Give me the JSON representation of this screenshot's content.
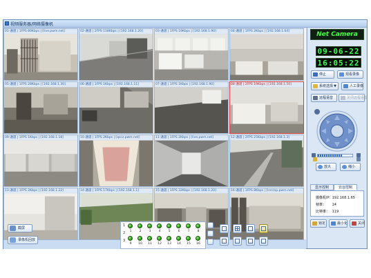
{
  "window": {
    "title": "视频服务器/网络摄像机"
  },
  "cameras": [
    {
      "caption": "01-通道 | 1FPS 80Kbps | [live.pwm.net]"
    },
    {
      "caption": "02-通道 | 2FPS 118Kbps | [192.168.1.20]"
    },
    {
      "caption": "03-通道 | 1FPS 19Kbps | [192.168.1.90]"
    },
    {
      "caption": "04-通道 | 1FPS 2Kbps | [192.168.1.64]"
    },
    {
      "caption": "05-通道 | 1FPS 28Kbps | [192.168.1.30]"
    },
    {
      "caption": "06-通道 | 1FPS 1Kbps | [192.168.1.11]"
    },
    {
      "caption": "07-通道 | 1FPS 1Kbps | [192.168.1.90]"
    },
    {
      "caption": "08-通道 | 2FPS 19Kbps | [192.168.1.50]"
    },
    {
      "caption": "09-通道 | 1FPS 1Kbps | [192.168.1.18]"
    },
    {
      "caption": "10-通道 | 1FPS 2Kbps | [qscz.pwm.net]"
    },
    {
      "caption": "11-通道 | 1FPS 2Kbps | [live.pwm.net]"
    },
    {
      "caption": "12-通道 | 2FPS 25Kbps | [192.168.1.3]"
    },
    {
      "caption": "13-通道 | 1FPS 2Kbps | [192.168.1.22]"
    },
    {
      "caption": "14-通道 | 1FPS 17Kbps | [192.168.1.1]"
    },
    {
      "caption": "15-通道 | 1FPS 32Kbps | [192.168.1.20]"
    },
    {
      "caption": "16-通道 | 1FPS 8Kbps | [lsrcmp.pwm.net]"
    }
  ],
  "bottom": {
    "btn_screenshot": "截屏",
    "btn_record": "录像机回放"
  },
  "channels": {
    "row1": [
      "1",
      "2",
      "3",
      "4",
      "5",
      "6",
      "7",
      "8"
    ],
    "row2": [
      "9",
      "10",
      "11",
      "12",
      "13",
      "14",
      "15",
      "16"
    ],
    "row_labels": [
      "1",
      "2",
      "3"
    ]
  },
  "right": {
    "logo": "Net Camera",
    "date": "09-06-22",
    "time": "16:05:22",
    "btn_stop": "停止",
    "btn_view_record": "观看录像",
    "btn_system": "系统选择",
    "btn_manual_record": "人工录像",
    "btn_remote_speak": "远程语音",
    "btn_stop_speak": "关闭远程语音",
    "btn_zoom_in": "放大",
    "btn_zoom_out": "缩小",
    "tab_display": "显示控制",
    "tab_ptz": "云台控制",
    "info": {
      "ip_label": "摄像机IP：",
      "ip_value": "192.168.1.65",
      "fps_label": "帧率：",
      "fps_value": "14",
      "bitrate_label": "比特率：",
      "bitrate_value": "119"
    },
    "btn_lock": "锁定",
    "btn_minimize": "最小化",
    "btn_close": "关闭"
  },
  "colors": {
    "accent": "#2d6fd1",
    "lcd_green": "#3bff52",
    "status_dot": "#2ea11d",
    "selected_border": "#d63a3a"
  }
}
